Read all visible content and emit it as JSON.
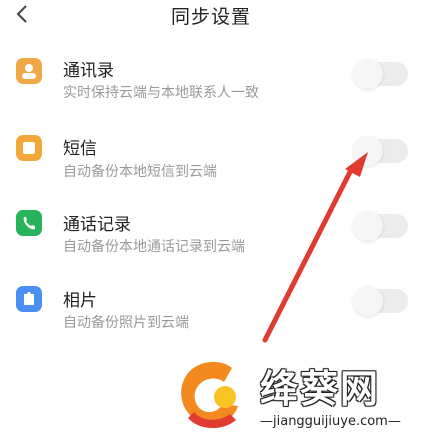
{
  "header": {
    "back_icon": "chevron-left-icon",
    "title": "同步设置"
  },
  "sync_items": [
    {
      "title": "通讯录",
      "description": "实时保持云端与本地联系人一致",
      "icon": "contacts-icon",
      "color": "#f0a848",
      "enabled": false
    },
    {
      "title": "短信",
      "description": "自动备份本地短信到云端",
      "icon": "sms-icon",
      "color": "#f3a83c",
      "enabled": false
    },
    {
      "title": "通话记录",
      "description": "自动备份本地通话记录到云端",
      "icon": "phone-icon",
      "color": "#27b35c",
      "enabled": false
    },
    {
      "title": "相片",
      "description": "自动备份照片到云端",
      "icon": "photo-icon",
      "color": "#4a8ef2",
      "enabled": false
    }
  ],
  "annotation": {
    "color": "#e03b2f"
  },
  "watermark": {
    "brand": "绛葵网",
    "url": "—jiangguijiuye.com—",
    "colors": {
      "orange": "#f28a1f",
      "red": "#e03b2f",
      "yellow": "#f7c325"
    }
  }
}
